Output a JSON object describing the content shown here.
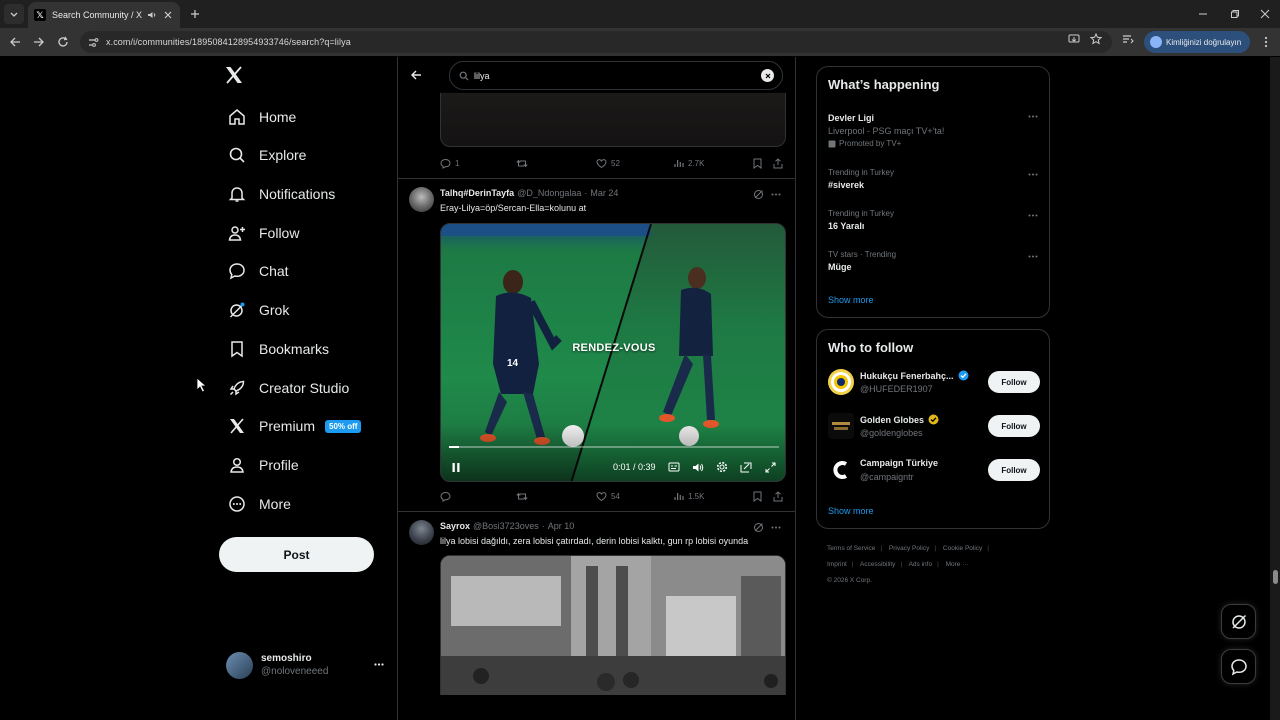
{
  "browser": {
    "tab_title": "Search Community / X",
    "url": "x.com/i/communities/1895084128954933746/search?q=lilya",
    "signin_label": "Kimliğinizi doğrulayın"
  },
  "sidebar": {
    "items": [
      {
        "label": "Home",
        "icon": "home-icon"
      },
      {
        "label": "Explore",
        "icon": "search-icon"
      },
      {
        "label": "Notifications",
        "icon": "bell-icon"
      },
      {
        "label": "Follow",
        "icon": "person-plus-icon"
      },
      {
        "label": "Chat",
        "icon": "chat-icon"
      },
      {
        "label": "Grok",
        "icon": "grok-icon"
      },
      {
        "label": "Bookmarks",
        "icon": "bookmark-icon"
      },
      {
        "label": "Creator Studio",
        "icon": "rocket-icon"
      },
      {
        "label": "Premium",
        "icon": "x-logo-icon"
      },
      {
        "label": "Profile",
        "icon": "person-icon"
      },
      {
        "label": "More",
        "icon": "more-circle-icon"
      }
    ],
    "premium_badge": "50% off",
    "post_label": "Post",
    "account": {
      "name": "semoshiro",
      "handle": "@noloveneeed"
    }
  },
  "search": {
    "query": "lilya"
  },
  "prev_tweet": {
    "replies": "1",
    "reposts": "",
    "likes": "52",
    "views": "2.7K"
  },
  "tweets": [
    {
      "name": "Talhq#DerinTayfa",
      "handle": "@D_Ndongalaa",
      "date": "Mar 24",
      "text": "Eray-Lilya=öp/Sercan-Ella=kolunu at",
      "video_caption": "RENDEZ-VOUS",
      "video_time": "0:01 / 0:39",
      "video_progress": 0.03,
      "replies": "",
      "reposts": "",
      "likes": "54",
      "views": "1.5K"
    },
    {
      "name": "Sayrox",
      "handle": "@Bosi3723oves",
      "date": "Apr 10",
      "text": "lilya lobisi dağıldı, zera lobisi çatırdadı, derin lobisi kalktı, gun rp lobisi oyunda"
    }
  ],
  "trends": {
    "title": "What’s happening",
    "items": [
      {
        "meta": "",
        "name": "Devler Ligi",
        "sub": "Liverpool - PSG maçı TV+'ta!",
        "promo": "Promoted by TV+"
      },
      {
        "meta": "Trending in Turkey",
        "name": "#siverek"
      },
      {
        "meta": "Trending in Turkey",
        "name": "16 Yaralı"
      },
      {
        "meta": "TV stars · Trending",
        "name": "Müge"
      }
    ],
    "show_more": "Show more"
  },
  "who_to_follow": {
    "title": "Who to follow",
    "items": [
      {
        "name": "Hukukçu Fenerbahç...",
        "handle": "@HUFEDER1907",
        "verified": "blue"
      },
      {
        "name": "Golden Globes",
        "handle": "@goldenglobes",
        "verified": "gold"
      },
      {
        "name": "Campaign Türkiye",
        "handle": "@campaigntr",
        "verified": ""
      }
    ],
    "follow_label": "Follow",
    "show_more": "Show more"
  },
  "footer": {
    "links": [
      "Terms of Service",
      "Privacy Policy",
      "Cookie Policy",
      "Imprint",
      "Accessibility",
      "Ads info",
      "More ···"
    ],
    "copyright": "© 2026 X Corp."
  },
  "colors": {
    "accent": "#1d9bf0",
    "bg": "#000000",
    "border": "#2f3336",
    "muted": "#71767b"
  }
}
